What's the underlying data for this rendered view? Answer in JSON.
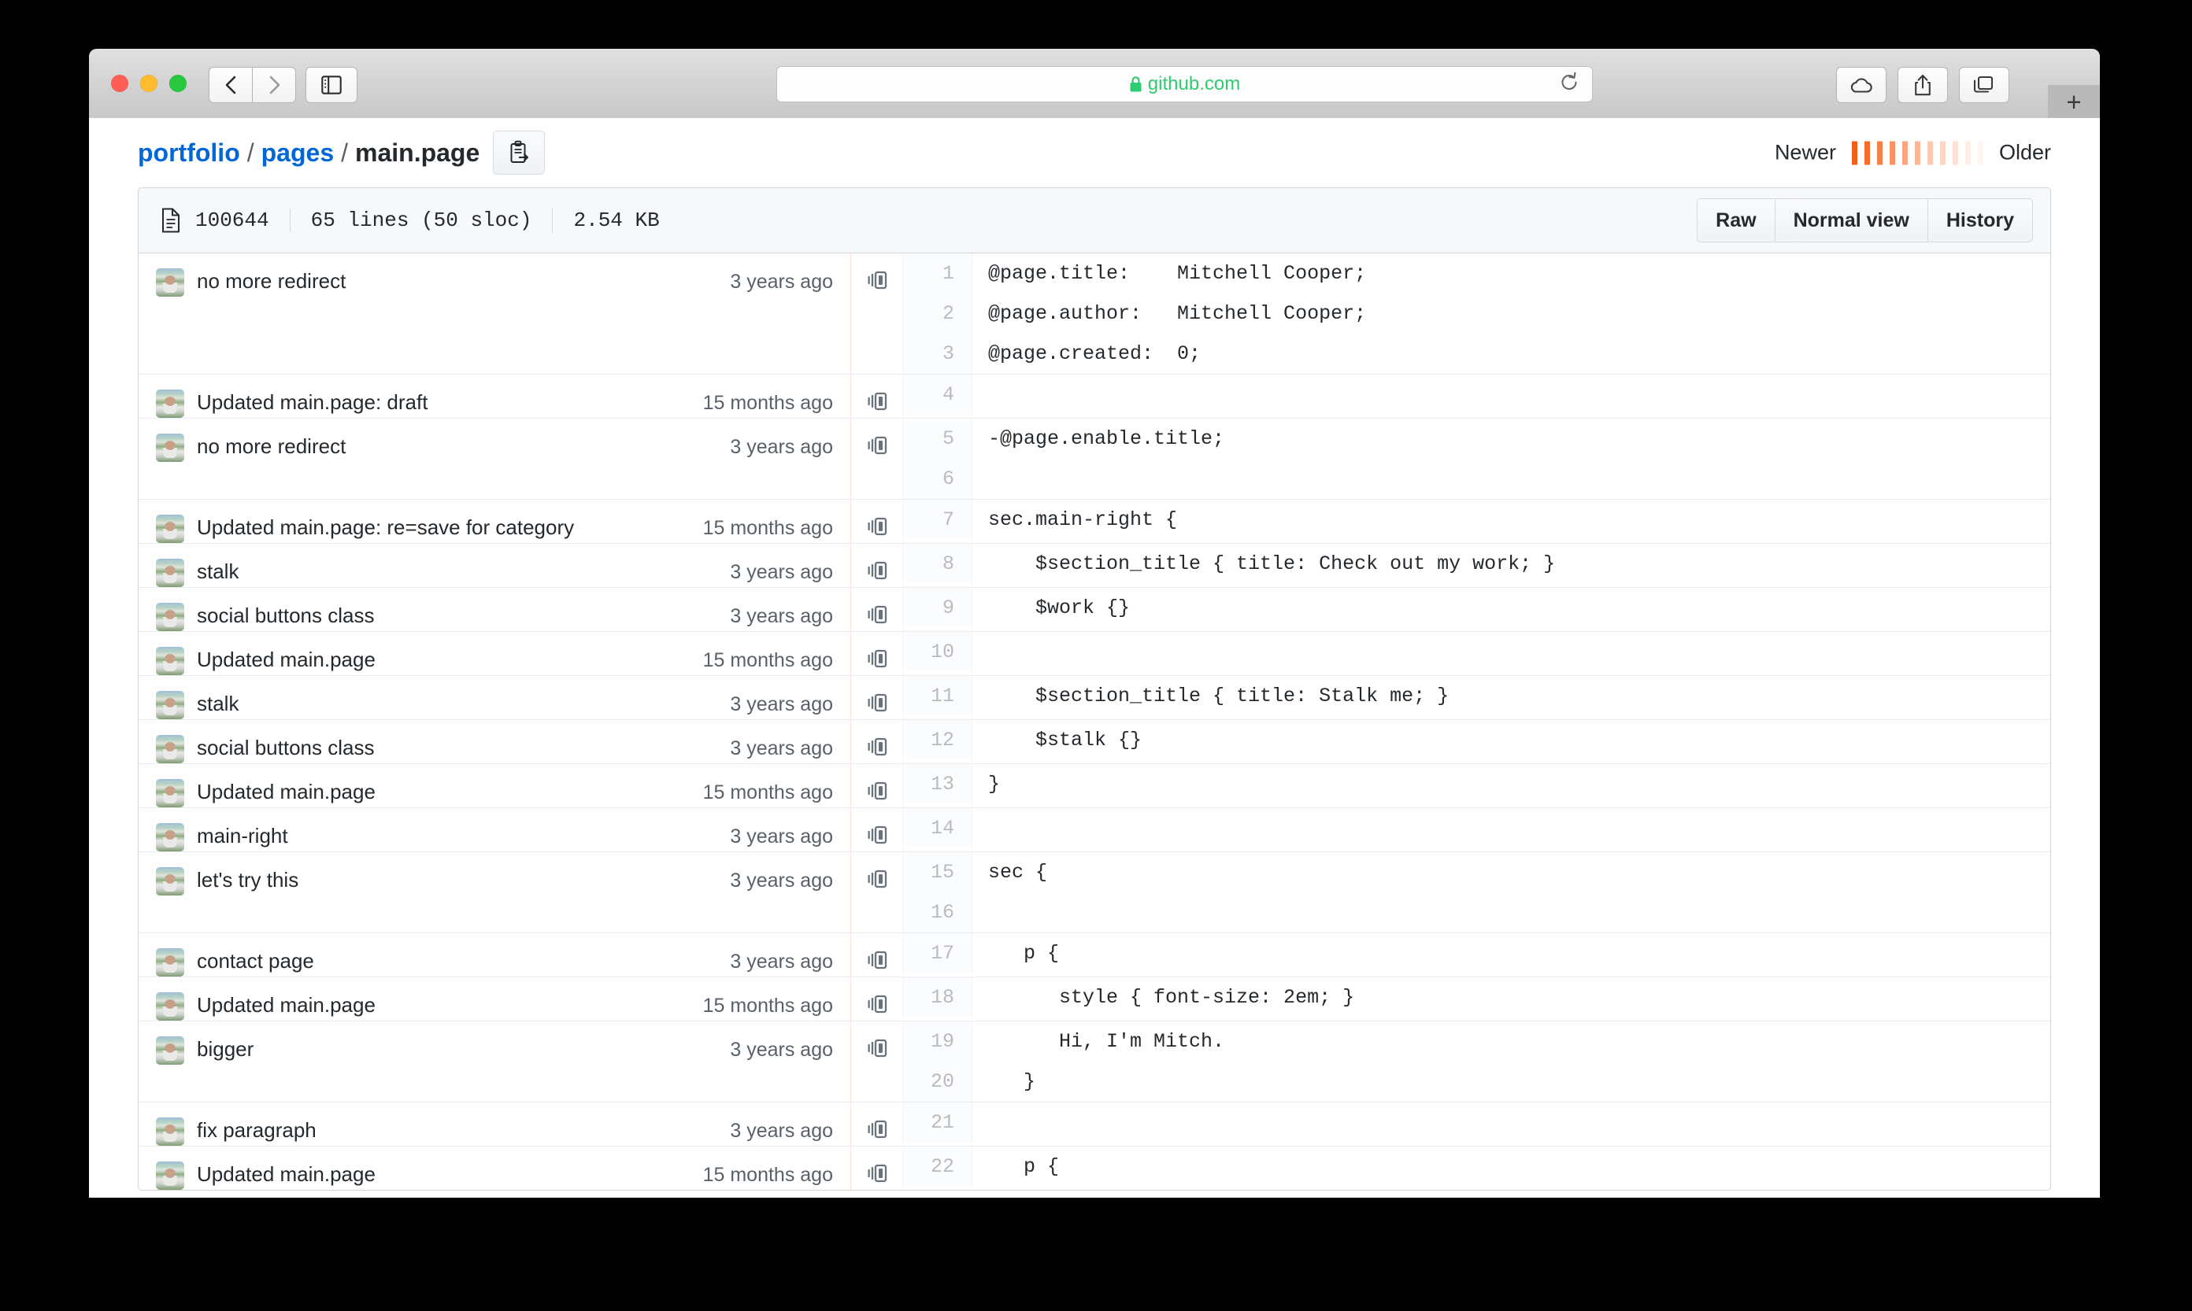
{
  "browser": {
    "traffic_lights": [
      "close-red",
      "minimize-yellow",
      "zoom-green"
    ],
    "back_label": "Back",
    "forward_label": "Forward",
    "sidebar_label": "Show sidebar",
    "url": "github.com",
    "lock_icon": "lock-icon",
    "reload_icon": "reload-icon",
    "icloud_label": "iCloud Tabs",
    "share_label": "Share",
    "tabs_label": "Show all tabs",
    "new_tab_label": "+"
  },
  "page_header": {
    "breadcrumb": {
      "repo": "portfolio",
      "folder": "pages",
      "file": "main.page",
      "separator": "/",
      "copy_icon": "copy-path-icon"
    },
    "age_graph": {
      "newer_label": "Newer",
      "older_label": "Older",
      "bar_opacities": [
        1,
        0.92,
        0.8,
        0.68,
        0.56,
        0.45,
        0.35,
        0.26,
        0.18,
        0.11,
        0.06
      ],
      "color": "#f4601c"
    }
  },
  "file_bar": {
    "icon": "file-icon",
    "mode": "100644",
    "lines": "65 lines (50 sloc)",
    "size": "2.54 KB",
    "buttons": [
      "Raw",
      "Normal view",
      "History"
    ]
  },
  "blame": {
    "reblame_icon": "reblame-icon",
    "rows": [
      {
        "message": "no more redirect",
        "time": "3 years ago",
        "lines": [
          {
            "n": "1",
            "code": "@page.title:    Mitchell Cooper;"
          },
          {
            "n": "2",
            "code": "@page.author:   Mitchell Cooper;"
          },
          {
            "n": "3",
            "code": "@page.created:  0;"
          }
        ]
      },
      {
        "message": "Updated main.page: draft",
        "time": "15 months ago",
        "lines": [
          {
            "n": "4",
            "code": ""
          }
        ]
      },
      {
        "message": "no more redirect",
        "time": "3 years ago",
        "lines": [
          {
            "n": "5",
            "code": "-@page.enable.title;"
          },
          {
            "n": "6",
            "code": ""
          }
        ]
      },
      {
        "message": "Updated main.page: re=save for category",
        "time": "15 months ago",
        "lines": [
          {
            "n": "7",
            "code": "sec.main-right {"
          }
        ]
      },
      {
        "message": "stalk",
        "time": "3 years ago",
        "lines": [
          {
            "n": "8",
            "code": "    $section_title { title: Check out my work; }"
          }
        ]
      },
      {
        "message": "social buttons class",
        "time": "3 years ago",
        "lines": [
          {
            "n": "9",
            "code": "    $work {}"
          }
        ]
      },
      {
        "message": "Updated main.page",
        "time": "15 months ago",
        "lines": [
          {
            "n": "10",
            "code": ""
          }
        ]
      },
      {
        "message": "stalk",
        "time": "3 years ago",
        "lines": [
          {
            "n": "11",
            "code": "    $section_title { title: Stalk me; }"
          }
        ]
      },
      {
        "message": "social buttons class",
        "time": "3 years ago",
        "lines": [
          {
            "n": "12",
            "code": "    $stalk {}"
          }
        ]
      },
      {
        "message": "Updated main.page",
        "time": "15 months ago",
        "lines": [
          {
            "n": "13",
            "code": "}"
          }
        ]
      },
      {
        "message": "main-right",
        "time": "3 years ago",
        "lines": [
          {
            "n": "14",
            "code": ""
          }
        ]
      },
      {
        "message": "let's try this",
        "time": "3 years ago",
        "lines": [
          {
            "n": "15",
            "code": "sec {"
          },
          {
            "n": "16",
            "code": ""
          }
        ]
      },
      {
        "message": "contact page",
        "time": "3 years ago",
        "lines": [
          {
            "n": "17",
            "code": "   p {"
          }
        ]
      },
      {
        "message": "Updated main.page",
        "time": "15 months ago",
        "lines": [
          {
            "n": "18",
            "code": "      style { font-size: 2em; }"
          }
        ]
      },
      {
        "message": "bigger",
        "time": "3 years ago",
        "lines": [
          {
            "n": "19",
            "code": "      Hi, I'm Mitch."
          },
          {
            "n": "20",
            "code": "   }"
          }
        ]
      },
      {
        "message": "fix paragraph",
        "time": "3 years ago",
        "lines": [
          {
            "n": "21",
            "code": ""
          }
        ]
      },
      {
        "message": "Updated main.page",
        "time": "15 months ago",
        "lines": [
          {
            "n": "22",
            "code": "   p {"
          }
        ]
      }
    ]
  }
}
